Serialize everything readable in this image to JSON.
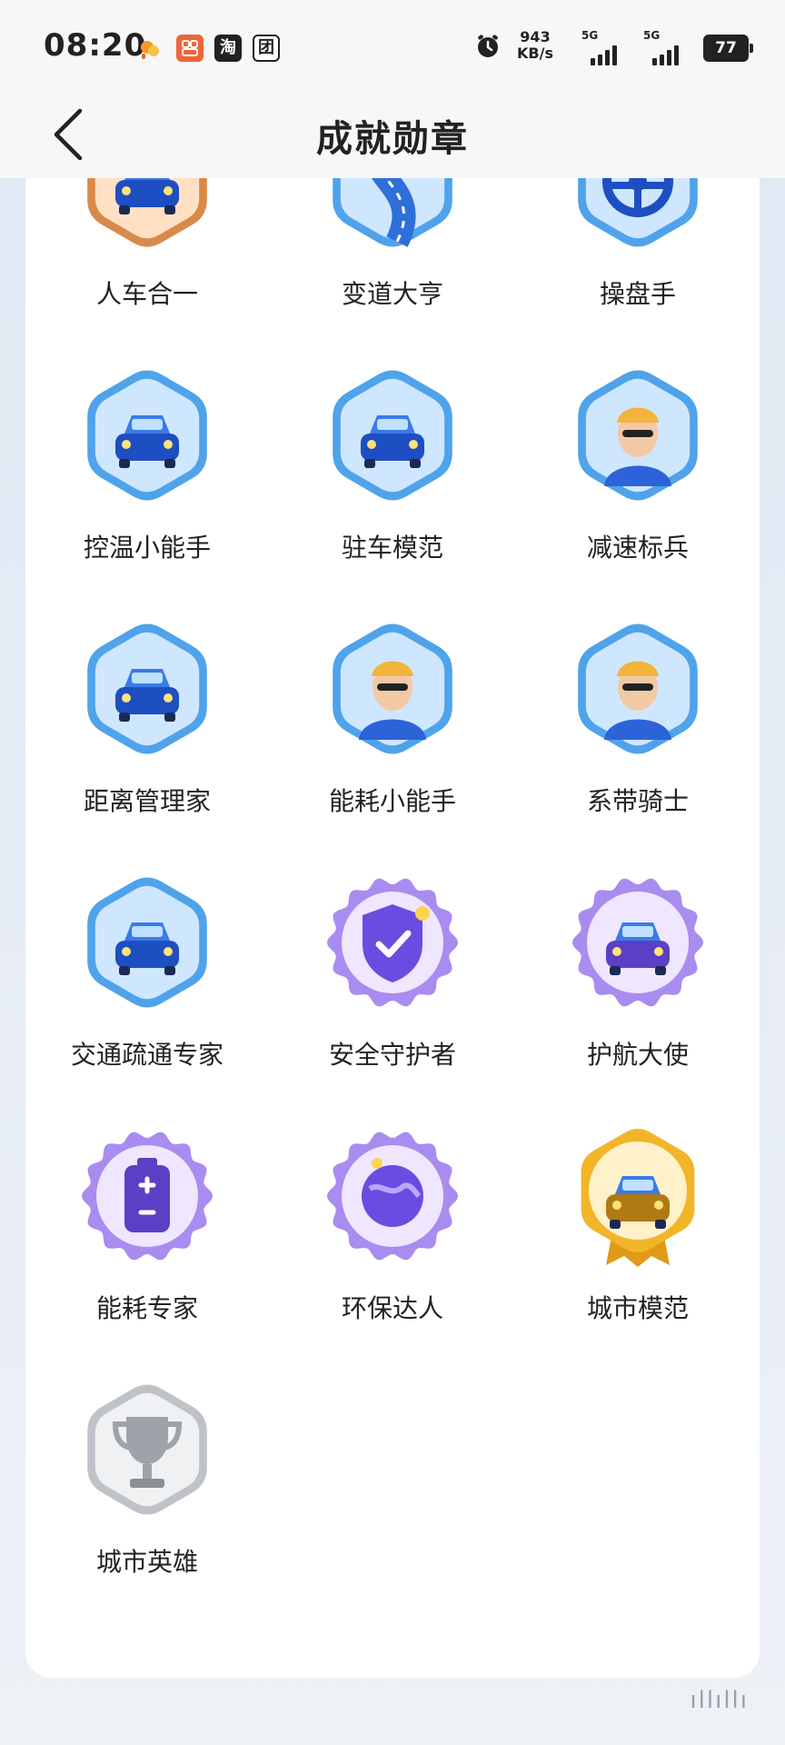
{
  "status_bar": {
    "time": "08:20",
    "app_icons": [
      "weather-icon",
      "app-orange-icon",
      "taobao-icon",
      "meituan-icon"
    ],
    "taobao_label": "淘",
    "meituan_label": "团",
    "net_speed_value": "943",
    "net_speed_unit": "KB/s",
    "signal1_label": "5G",
    "signal2_label": "5G",
    "battery": "77"
  },
  "header": {
    "title": "成就勋章"
  },
  "badges": [
    {
      "name": "人车合一",
      "style": "orange",
      "icon": "car-front-icon"
    },
    {
      "name": "变道大亨",
      "style": "blue",
      "icon": "road-curve-icon"
    },
    {
      "name": "操盘手",
      "style": "blue",
      "icon": "steering-wheel-icon"
    },
    {
      "name": "控温小能手",
      "style": "blue",
      "icon": "car-weather-icon"
    },
    {
      "name": "驻车模范",
      "style": "blue",
      "icon": "parking-car-icon"
    },
    {
      "name": "减速标兵",
      "style": "blue",
      "icon": "driver-sunglasses-icon"
    },
    {
      "name": "距离管理家",
      "style": "blue",
      "icon": "two-cars-icon"
    },
    {
      "name": "能耗小能手",
      "style": "blue",
      "icon": "driver-cap-icon"
    },
    {
      "name": "系带骑士",
      "style": "blue",
      "icon": "seatbelt-driver-icon"
    },
    {
      "name": "交通疏通专家",
      "style": "blue",
      "icon": "traffic-cone-car-icon"
    },
    {
      "name": "安全守护者",
      "style": "purple",
      "icon": "shield-check-icon"
    },
    {
      "name": "护航大使",
      "style": "purple",
      "icon": "car-shield-icon"
    },
    {
      "name": "能耗专家",
      "style": "purple",
      "icon": "battery-icon"
    },
    {
      "name": "环保达人",
      "style": "purple",
      "icon": "earth-hands-icon"
    },
    {
      "name": "城市模范",
      "style": "gold",
      "icon": "city-car-icon"
    },
    {
      "name": "城市英雄",
      "style": "silver",
      "icon": "trophy-icon"
    }
  ],
  "colors": {
    "blue_badge": "#4fa3ea",
    "purple_badge": "#a98cf0",
    "gold_badge": "#f2b52a",
    "silver_badge": "#bfc3c8",
    "orange_badge": "#d98a4a"
  }
}
